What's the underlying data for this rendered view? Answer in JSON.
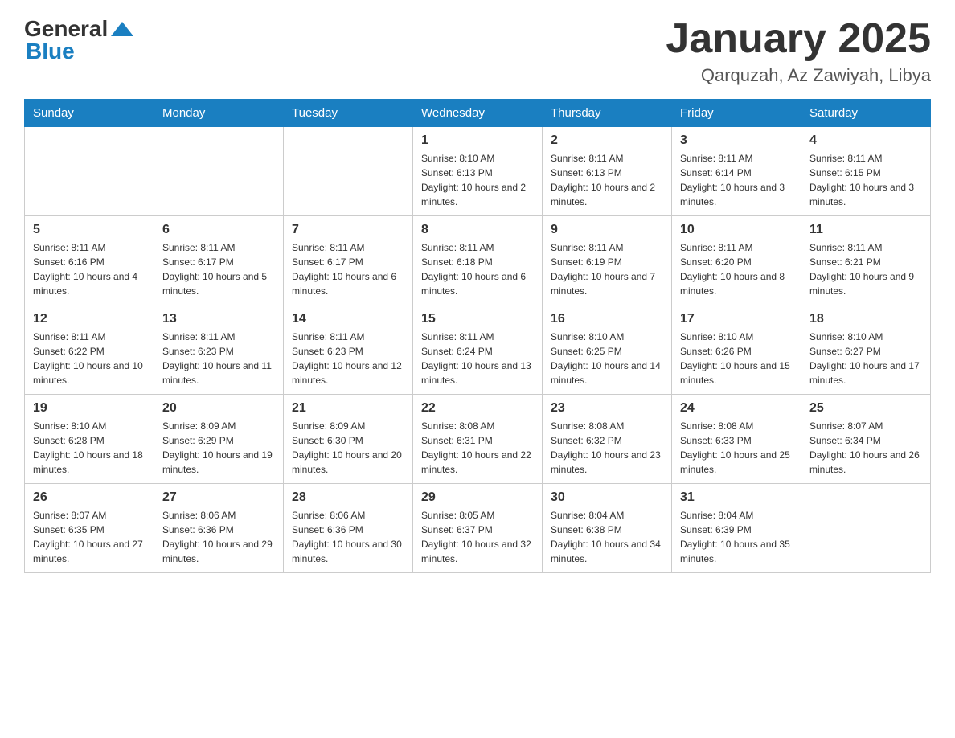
{
  "logo": {
    "general": "General",
    "blue": "Blue"
  },
  "title": "January 2025",
  "subtitle": "Qarquzah, Az Zawiyah, Libya",
  "days_of_week": [
    "Sunday",
    "Monday",
    "Tuesday",
    "Wednesday",
    "Thursday",
    "Friday",
    "Saturday"
  ],
  "weeks": [
    [
      {
        "day": "",
        "info": ""
      },
      {
        "day": "",
        "info": ""
      },
      {
        "day": "",
        "info": ""
      },
      {
        "day": "1",
        "info": "Sunrise: 8:10 AM\nSunset: 6:13 PM\nDaylight: 10 hours and 2 minutes."
      },
      {
        "day": "2",
        "info": "Sunrise: 8:11 AM\nSunset: 6:13 PM\nDaylight: 10 hours and 2 minutes."
      },
      {
        "day": "3",
        "info": "Sunrise: 8:11 AM\nSunset: 6:14 PM\nDaylight: 10 hours and 3 minutes."
      },
      {
        "day": "4",
        "info": "Sunrise: 8:11 AM\nSunset: 6:15 PM\nDaylight: 10 hours and 3 minutes."
      }
    ],
    [
      {
        "day": "5",
        "info": "Sunrise: 8:11 AM\nSunset: 6:16 PM\nDaylight: 10 hours and 4 minutes."
      },
      {
        "day": "6",
        "info": "Sunrise: 8:11 AM\nSunset: 6:17 PM\nDaylight: 10 hours and 5 minutes."
      },
      {
        "day": "7",
        "info": "Sunrise: 8:11 AM\nSunset: 6:17 PM\nDaylight: 10 hours and 6 minutes."
      },
      {
        "day": "8",
        "info": "Sunrise: 8:11 AM\nSunset: 6:18 PM\nDaylight: 10 hours and 6 minutes."
      },
      {
        "day": "9",
        "info": "Sunrise: 8:11 AM\nSunset: 6:19 PM\nDaylight: 10 hours and 7 minutes."
      },
      {
        "day": "10",
        "info": "Sunrise: 8:11 AM\nSunset: 6:20 PM\nDaylight: 10 hours and 8 minutes."
      },
      {
        "day": "11",
        "info": "Sunrise: 8:11 AM\nSunset: 6:21 PM\nDaylight: 10 hours and 9 minutes."
      }
    ],
    [
      {
        "day": "12",
        "info": "Sunrise: 8:11 AM\nSunset: 6:22 PM\nDaylight: 10 hours and 10 minutes."
      },
      {
        "day": "13",
        "info": "Sunrise: 8:11 AM\nSunset: 6:23 PM\nDaylight: 10 hours and 11 minutes."
      },
      {
        "day": "14",
        "info": "Sunrise: 8:11 AM\nSunset: 6:23 PM\nDaylight: 10 hours and 12 minutes."
      },
      {
        "day": "15",
        "info": "Sunrise: 8:11 AM\nSunset: 6:24 PM\nDaylight: 10 hours and 13 minutes."
      },
      {
        "day": "16",
        "info": "Sunrise: 8:10 AM\nSunset: 6:25 PM\nDaylight: 10 hours and 14 minutes."
      },
      {
        "day": "17",
        "info": "Sunrise: 8:10 AM\nSunset: 6:26 PM\nDaylight: 10 hours and 15 minutes."
      },
      {
        "day": "18",
        "info": "Sunrise: 8:10 AM\nSunset: 6:27 PM\nDaylight: 10 hours and 17 minutes."
      }
    ],
    [
      {
        "day": "19",
        "info": "Sunrise: 8:10 AM\nSunset: 6:28 PM\nDaylight: 10 hours and 18 minutes."
      },
      {
        "day": "20",
        "info": "Sunrise: 8:09 AM\nSunset: 6:29 PM\nDaylight: 10 hours and 19 minutes."
      },
      {
        "day": "21",
        "info": "Sunrise: 8:09 AM\nSunset: 6:30 PM\nDaylight: 10 hours and 20 minutes."
      },
      {
        "day": "22",
        "info": "Sunrise: 8:08 AM\nSunset: 6:31 PM\nDaylight: 10 hours and 22 minutes."
      },
      {
        "day": "23",
        "info": "Sunrise: 8:08 AM\nSunset: 6:32 PM\nDaylight: 10 hours and 23 minutes."
      },
      {
        "day": "24",
        "info": "Sunrise: 8:08 AM\nSunset: 6:33 PM\nDaylight: 10 hours and 25 minutes."
      },
      {
        "day": "25",
        "info": "Sunrise: 8:07 AM\nSunset: 6:34 PM\nDaylight: 10 hours and 26 minutes."
      }
    ],
    [
      {
        "day": "26",
        "info": "Sunrise: 8:07 AM\nSunset: 6:35 PM\nDaylight: 10 hours and 27 minutes."
      },
      {
        "day": "27",
        "info": "Sunrise: 8:06 AM\nSunset: 6:36 PM\nDaylight: 10 hours and 29 minutes."
      },
      {
        "day": "28",
        "info": "Sunrise: 8:06 AM\nSunset: 6:36 PM\nDaylight: 10 hours and 30 minutes."
      },
      {
        "day": "29",
        "info": "Sunrise: 8:05 AM\nSunset: 6:37 PM\nDaylight: 10 hours and 32 minutes."
      },
      {
        "day": "30",
        "info": "Sunrise: 8:04 AM\nSunset: 6:38 PM\nDaylight: 10 hours and 34 minutes."
      },
      {
        "day": "31",
        "info": "Sunrise: 8:04 AM\nSunset: 6:39 PM\nDaylight: 10 hours and 35 minutes."
      },
      {
        "day": "",
        "info": ""
      }
    ]
  ]
}
